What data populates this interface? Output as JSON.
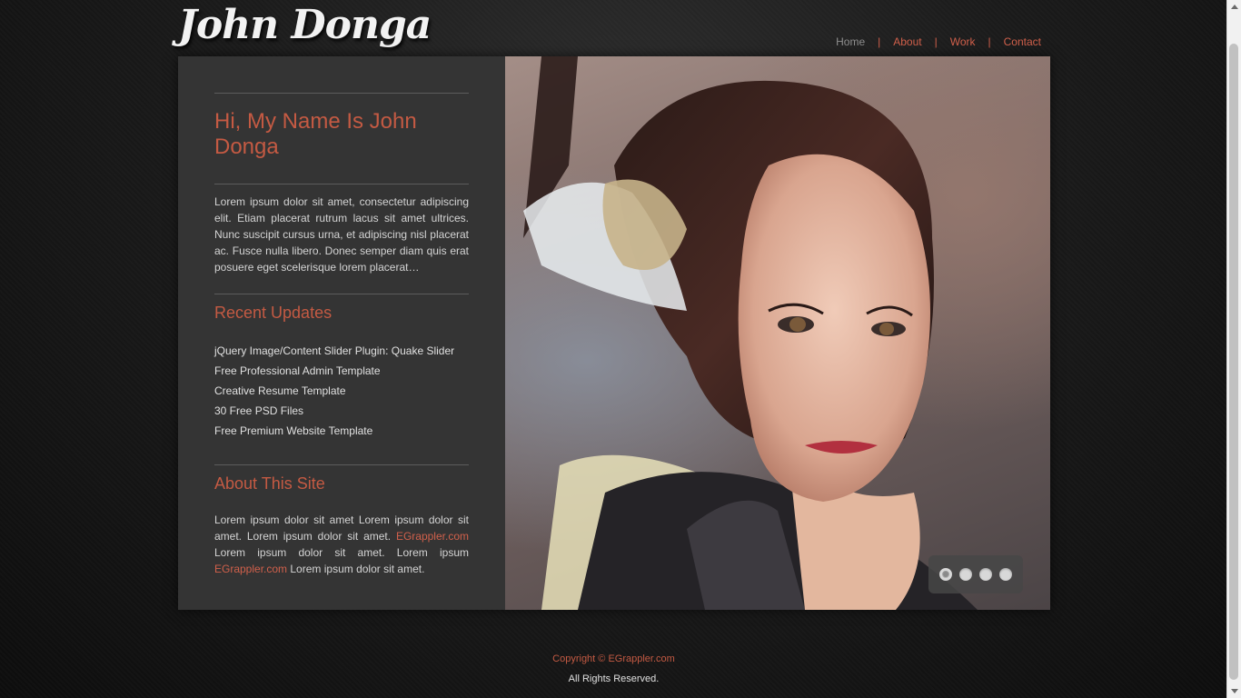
{
  "site": {
    "logo": "John Donga"
  },
  "nav": {
    "items": [
      {
        "label": "Home"
      },
      {
        "label": "About"
      },
      {
        "label": "Work"
      },
      {
        "label": "Contact"
      }
    ],
    "separator": "|"
  },
  "intro": {
    "title": "Hi, My Name Is John Donga",
    "text": "Lorem ipsum dolor sit amet, consectetur adipiscing elit. Etiam placerat rutrum lacus sit amet ultrices. Nunc suscipit cursus urna, et adipiscing nisl placerat ac. Fusce nulla libero. Donec semper diam quis erat posuere eget scelerisque lorem placerat…"
  },
  "updates": {
    "title": "Recent Updates",
    "items": [
      "jQuery Image/Content Slider Plugin: Quake Slider",
      "Free Professional Admin Template",
      "Creative Resume Template",
      "30 Free PSD Files",
      "Free Premium Website Template"
    ]
  },
  "about": {
    "title": "About This Site",
    "text1": "Lorem ipsum dolor sit amet Lorem ipsum dolor sit amet. Lorem ipsum dolor sit amet. ",
    "link1": "EGrappler.com",
    "text2": " Lorem ipsum dolor sit amet. Lorem ipsum ",
    "link2": "EGrappler.com",
    "text3": " Lorem ipsum dolor sit amet."
  },
  "slider": {
    "slide_count": 4,
    "active_index": 0
  },
  "footer": {
    "copyright": "Copyright © ",
    "link": "EGrappler.com",
    "rights": "All Rights Reserved."
  },
  "colors": {
    "accent": "#c45a43",
    "panel": "#343434"
  }
}
